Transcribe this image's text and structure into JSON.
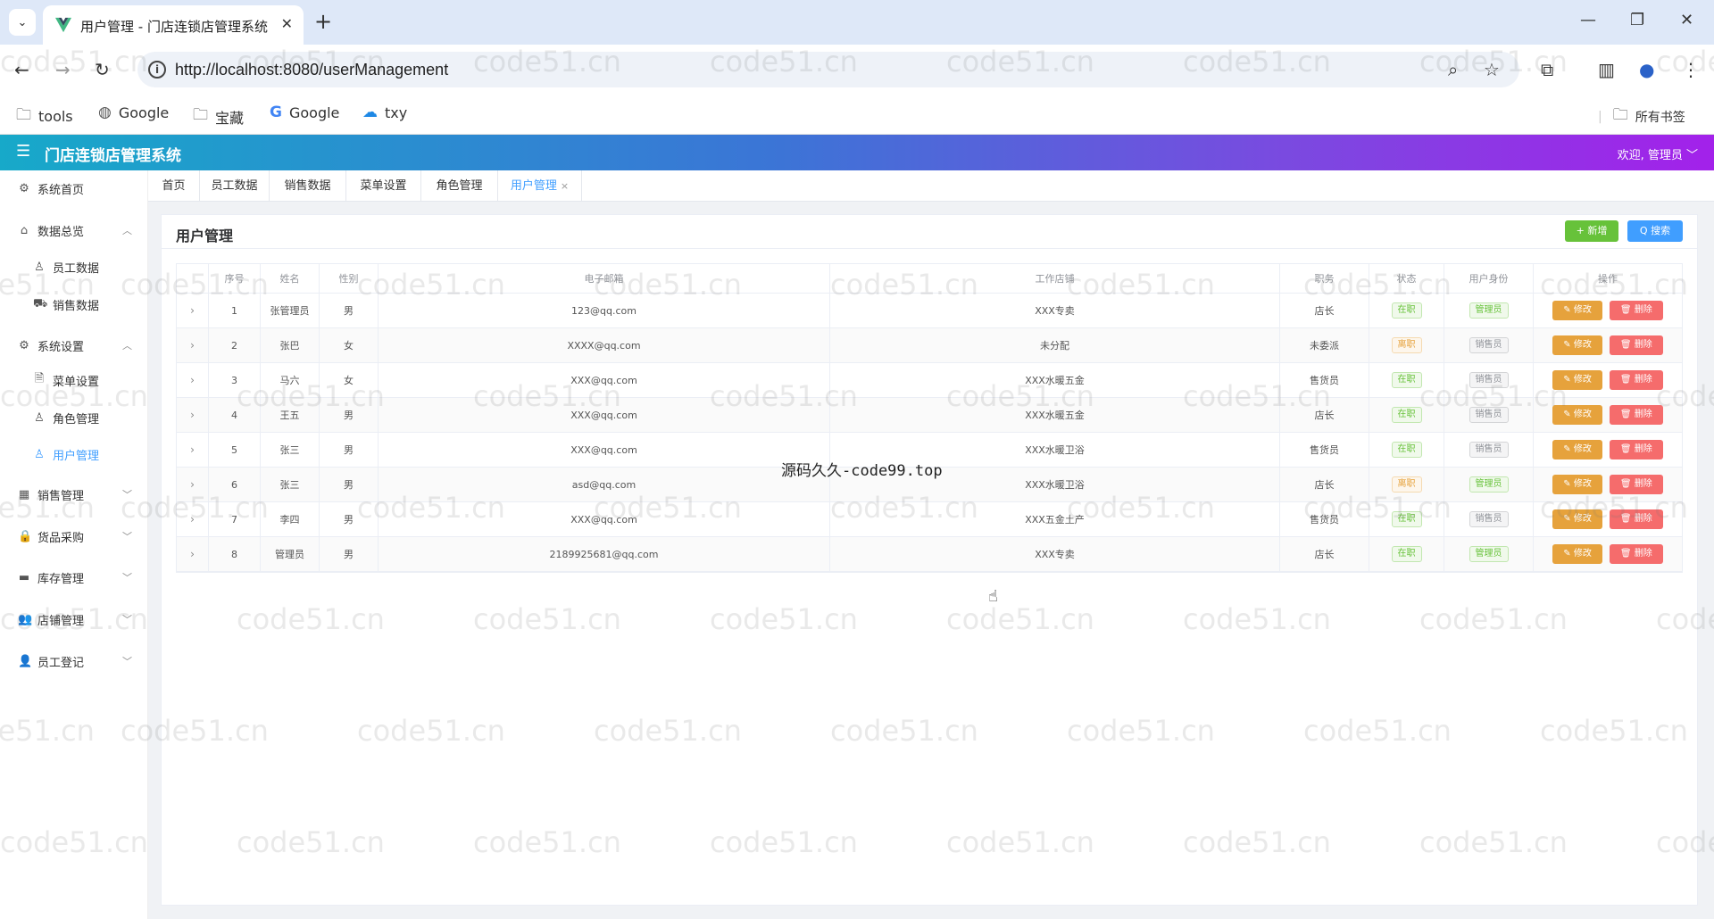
{
  "browser": {
    "tab_title": "用户管理 - 门店连锁店管理系统",
    "tab_close": "✕",
    "new_tab": "+",
    "url": "http://localhost:8080/userManagement",
    "bookmarks": [
      {
        "label": "tools",
        "icon": "folder-icon"
      },
      {
        "label": "Google",
        "icon": "globe-icon"
      },
      {
        "label": "宝藏",
        "icon": "folder-icon"
      },
      {
        "label": "Google",
        "icon": "google-icon"
      },
      {
        "label": "txy",
        "icon": "cloud-icon"
      }
    ],
    "all_bookmarks": "所有书签"
  },
  "header": {
    "app_title": "门店连锁店管理系统",
    "welcome": "欢迎, 管理员 ﹀"
  },
  "sidebar": {
    "items": [
      {
        "label": "系统首页",
        "icon": "gear-icon",
        "arrow": ""
      },
      {
        "label": "数据总览",
        "icon": "home-icon",
        "arrow": "︿"
      },
      {
        "label": "员工数据",
        "icon": "user-icon",
        "arrow": ""
      },
      {
        "label": "销售数据",
        "icon": "truck-icon",
        "arrow": ""
      },
      {
        "label": "系统设置",
        "icon": "settings-icon",
        "arrow": "︿"
      },
      {
        "label": "菜单设置",
        "icon": "document-icon",
        "arrow": ""
      },
      {
        "label": "角色管理",
        "icon": "user-icon",
        "arrow": ""
      },
      {
        "label": "用户管理",
        "icon": "user-icon",
        "arrow": ""
      },
      {
        "label": "销售管理",
        "icon": "chart-icon",
        "arrow": "﹀"
      },
      {
        "label": "货品采购",
        "icon": "lock-icon",
        "arrow": "﹀"
      },
      {
        "label": "库存管理",
        "icon": "box-icon",
        "arrow": "﹀"
      },
      {
        "label": "店铺管理",
        "icon": "user-group-icon",
        "arrow": "﹀"
      },
      {
        "label": "员工登记",
        "icon": "person-icon",
        "arrow": "﹀"
      }
    ]
  },
  "page_tabs": [
    "首页",
    "员工数据",
    "销售数据",
    "菜单设置",
    "角色管理",
    "用户管理"
  ],
  "page_tab_close": "×",
  "card": {
    "title": "用户管理",
    "add_button": "+ 新增",
    "search_button": "Q 搜索"
  },
  "table": {
    "headers": [
      "",
      "序号",
      "姓名",
      "性别",
      "电子邮箱",
      "工作店铺",
      "职务",
      "状态",
      "用户身份",
      "操作"
    ],
    "expand_glyph": "›",
    "edit_label": "✎ 修改",
    "delete_label": "🗑 删除",
    "rows": [
      {
        "no": "1",
        "name": "张管理员",
        "gender": "男",
        "email": "123@qq.com",
        "store": "XXX专卖",
        "position": "店长",
        "status": "在职",
        "status_type": "on",
        "role": "管理员",
        "role_type": "admin"
      },
      {
        "no": "2",
        "name": "张巴",
        "gender": "女",
        "email": "XXXX@qq.com",
        "store": "未分配",
        "position": "未委派",
        "status": "离职",
        "status_type": "off",
        "role": "销售员",
        "role_type": "sales"
      },
      {
        "no": "3",
        "name": "马六",
        "gender": "女",
        "email": "XXX@qq.com",
        "store": "XXX水暖五金",
        "position": "售货员",
        "status": "在职",
        "status_type": "on",
        "role": "销售员",
        "role_type": "sales"
      },
      {
        "no": "4",
        "name": "王五",
        "gender": "男",
        "email": "XXX@qq.com",
        "store": "XXX水暖五金",
        "position": "店长",
        "status": "在职",
        "status_type": "on",
        "role": "销售员",
        "role_type": "sales"
      },
      {
        "no": "5",
        "name": "张三",
        "gender": "男",
        "email": "XXX@qq.com",
        "store": "XXX水暖卫浴",
        "position": "售货员",
        "status": "在职",
        "status_type": "on",
        "role": "销售员",
        "role_type": "sales"
      },
      {
        "no": "6",
        "name": "张三",
        "gender": "男",
        "email": "asd@qq.com",
        "store": "XXX水暖卫浴",
        "position": "店长",
        "status": "离职",
        "status_type": "off",
        "role": "管理员",
        "role_type": "admin"
      },
      {
        "no": "7",
        "name": "李四",
        "gender": "男",
        "email": "XXX@qq.com",
        "store": "XXX五金土产",
        "position": "售货员",
        "status": "在职",
        "status_type": "on",
        "role": "销售员",
        "role_type": "sales"
      },
      {
        "no": "8",
        "name": "管理员",
        "gender": "男",
        "email": "2189925681@qq.com",
        "store": "XXX专卖",
        "position": "店长",
        "status": "在职",
        "status_type": "on",
        "role": "管理员",
        "role_type": "admin"
      }
    ]
  },
  "watermark_text": "code51.cn",
  "center_watermark": "源码久久-code99.top"
}
